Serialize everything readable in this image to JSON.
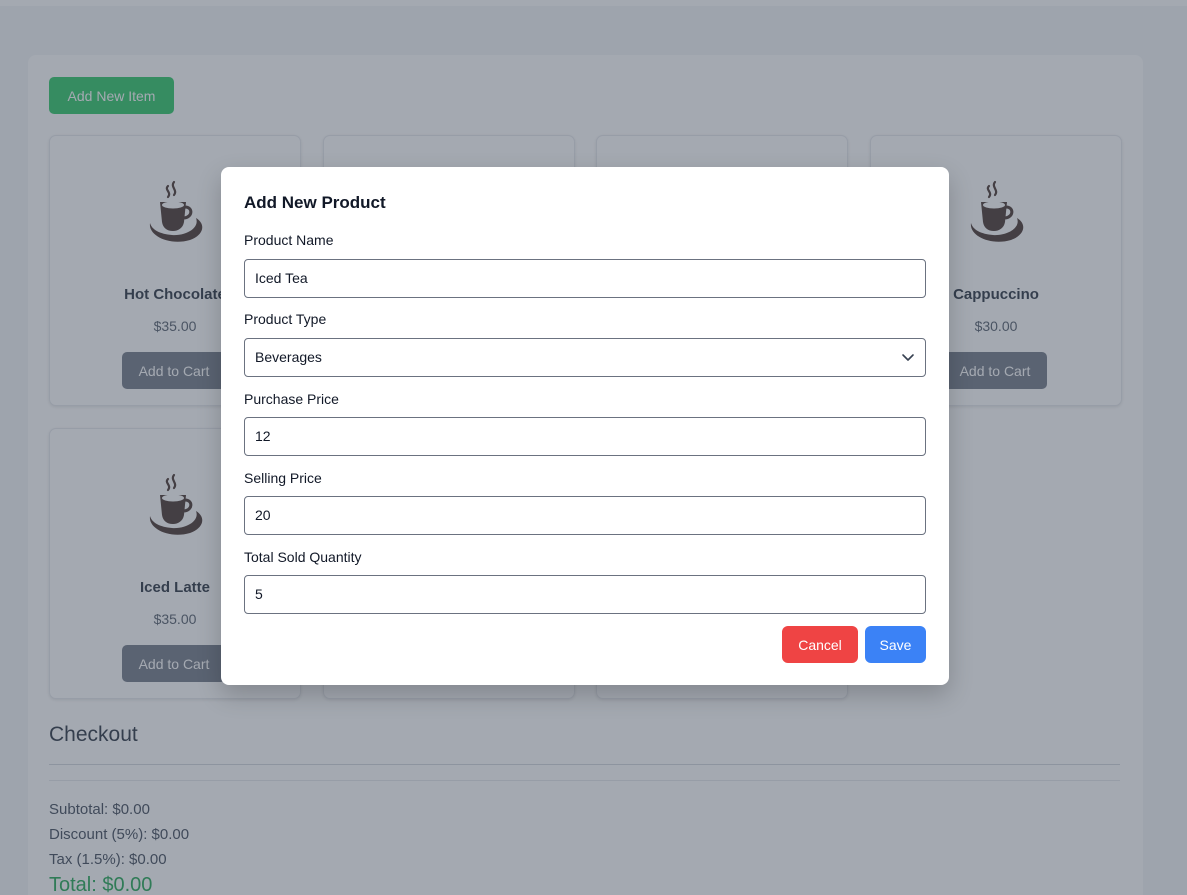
{
  "toolbar": {
    "add_new_label": "Add New Item"
  },
  "products": [
    {
      "name": "Hot Chocolate",
      "price": "$35.00",
      "cart_label": "Add to Cart"
    },
    {
      "name": "",
      "price": "",
      "cart_label": ""
    },
    {
      "name": "",
      "price": "",
      "cart_label": ""
    },
    {
      "name": "Cappuccino",
      "price": "$30.00",
      "cart_label": "Add to Cart"
    },
    {
      "name": "Iced Latte",
      "price": "$35.00",
      "cart_label": "Add to Cart"
    },
    {
      "name": "",
      "price": "",
      "cart_label": ""
    },
    {
      "name": "",
      "price": "",
      "cart_label": ""
    }
  ],
  "checkout": {
    "title": "Checkout",
    "subtotal": "Subtotal: $0.00",
    "discount": "Discount (5%): $0.00",
    "tax": "Tax (1.5%): $0.00",
    "total": "Total: $0.00"
  },
  "modal": {
    "title": "Add New Product",
    "product_name_label": "Product Name",
    "product_name_value": "Iced Tea",
    "product_type_label": "Product Type",
    "product_type_value": "Beverages",
    "purchase_price_label": "Purchase Price",
    "purchase_price_value": "12",
    "selling_price_label": "Selling Price",
    "selling_price_value": "20",
    "quantity_label": "Total Sold Quantity",
    "quantity_value": "5",
    "cancel_label": "Cancel",
    "save_label": "Save"
  },
  "colors": {
    "add_new": "#22c55e",
    "cart_button": "#6b7280",
    "cancel": "#ef4444",
    "save": "#3b82f6",
    "total": "#16a34a",
    "coffee_icon": "#3f2a24"
  },
  "icons": {
    "product": "coffee-cup-icon",
    "select": "chevron-down-icon"
  }
}
